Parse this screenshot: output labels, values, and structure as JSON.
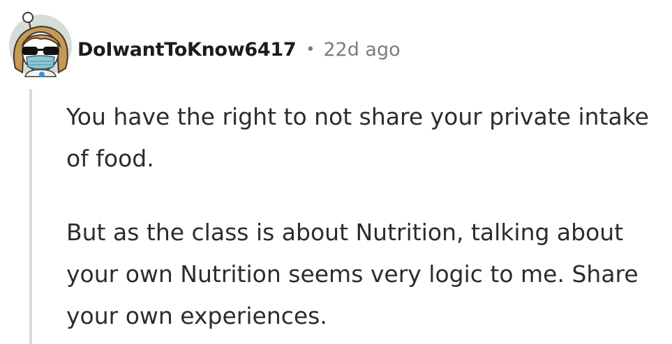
{
  "comment": {
    "author": "DoIwantToKnow6417",
    "separator": "•",
    "timestamp": "22d ago",
    "paragraphs": [
      "You have the right to not share your private intake of food.",
      "But as the class is about Nutrition, talking about your own Nutrition seems very logic to me. Share your own experiences."
    ]
  },
  "colors": {
    "text": "#2c2c2c",
    "meta": "#7c7c7c",
    "thread_line": "#dadada",
    "avatar_background": "#d6ddd8"
  },
  "icons": {
    "avatar": "user-avatar"
  }
}
